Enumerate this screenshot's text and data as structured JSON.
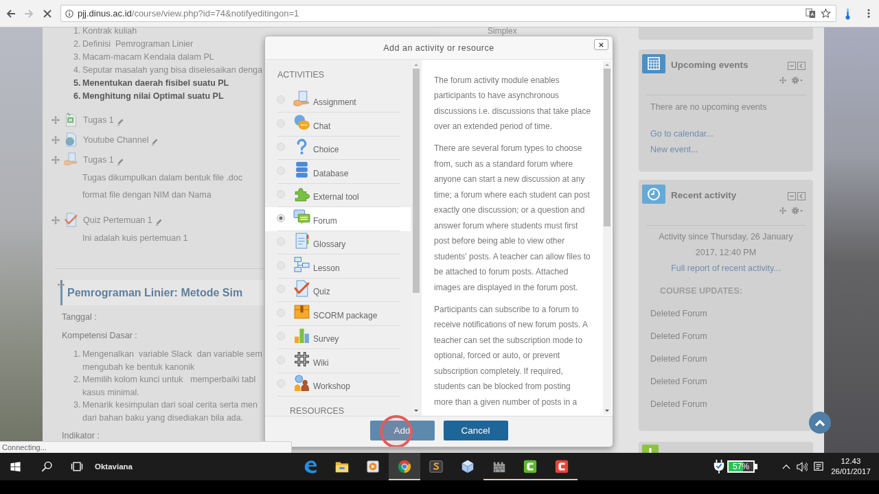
{
  "browser": {
    "url_host": "pjj.dinus.ac.id",
    "url_path": "/course/view.php?id=74&notifyeditingon=1",
    "loading": true
  },
  "page": {
    "topics": [
      {
        "number": "1.",
        "text": "Kontrak kuliah",
        "bold": false
      },
      {
        "number": "2.",
        "text": "Definisi  Pemrograman Linier",
        "bold": false
      },
      {
        "number": "3.",
        "text": "Macam-macam Kendala dalam PL",
        "bold": false
      },
      {
        "number": "4.",
        "text": "Seputar masalah yang bisa diselesaikan denga",
        "bold": false
      },
      {
        "number": "5.",
        "text": "Menentukan daerah fisibel suatu PL",
        "bold": true
      },
      {
        "number": "6.",
        "text": "Menghitung nilai Optimal suatu PL",
        "bold": true
      }
    ],
    "activities": [
      {
        "kind": "spreadsheet",
        "name": "Tugas 1"
      },
      {
        "kind": "url",
        "name": "Youtube Channel"
      },
      {
        "kind": "assignment",
        "name": "Tugas 1",
        "description": [
          "Tugas dikumpulkan dalam bentuk file .doc",
          "format file dengan NIM dan Nama"
        ]
      },
      {
        "kind": "quiz",
        "name": "Quiz Pertemuan 1",
        "description": [
          "Ini adalah kuis pertemuan 1"
        ]
      }
    ],
    "section": {
      "title": "Pemrograman Linier: Metode Sim",
      "date_label": "Tanggal :",
      "competence_label": "Kompetensi Dasar :",
      "competences": [
        {
          "number": "1.",
          "lines": [
            "Mengenalkan  variable Slack  dan variable sem",
            "mengubah ke bentuk kanonik"
          ]
        },
        {
          "number": "2.",
          "lines": [
            "Memilih kolom kunci untuk   memperbaiki tabl",
            "kasus minimal."
          ]
        },
        {
          "number": "3.",
          "lines": [
            "Menarik kesimpulan dari soal cerita serta men",
            "dari bahan baku yang disediakan bila ada."
          ]
        }
      ],
      "indicator_label": "Indikator :"
    },
    "side_text": "Simplex"
  },
  "sidebar": {
    "upcoming_events": {
      "title": "Upcoming events",
      "message": "There are no upcoming events",
      "links": [
        "Go to calendar...",
        "New event..."
      ]
    },
    "recent_activity": {
      "title": "Recent activity",
      "since": "Activity since Thursday, 26 January 2017, 12:40 PM",
      "report_link": "Full report of recent activity...",
      "updates_heading": "COURSE UPDATES:",
      "updates": [
        "Deleted Forum",
        "Deleted Forum",
        "Deleted Forum",
        "Deleted Forum",
        "Deleted Forum"
      ]
    }
  },
  "modal": {
    "title": "Add an activity or resource",
    "activities_heading": "ACTIVITIES",
    "activities": [
      {
        "kind": "assignment",
        "label": "Assignment",
        "selected": false
      },
      {
        "kind": "chat",
        "label": "Chat",
        "selected": false
      },
      {
        "kind": "choice",
        "label": "Choice",
        "selected": false
      },
      {
        "kind": "database",
        "label": "Database",
        "selected": false
      },
      {
        "kind": "lti",
        "label": "External tool",
        "selected": false
      },
      {
        "kind": "forum",
        "label": "Forum",
        "selected": true
      },
      {
        "kind": "glossary",
        "label": "Glossary",
        "selected": false
      },
      {
        "kind": "lesson",
        "label": "Lesson",
        "selected": false
      },
      {
        "kind": "quiz",
        "label": "Quiz",
        "selected": false
      },
      {
        "kind": "scorm",
        "label": "SCORM package",
        "selected": false
      },
      {
        "kind": "survey",
        "label": "Survey",
        "selected": false
      },
      {
        "kind": "wiki",
        "label": "Wiki",
        "selected": false
      },
      {
        "kind": "workshop",
        "label": "Workshop",
        "selected": false
      }
    ],
    "resources_heading": "RESOURCES",
    "description": [
      [
        "The forum activity module enables",
        "participants to have asynchronous",
        "discussions i.e. discussions that take place",
        "over an extended period of time."
      ],
      [
        "There are several forum types to choose",
        "from, such as a standard forum where",
        "anyone can start a new discussion at any",
        "time; a forum where each student can post",
        "exactly one discussion; or a question and",
        "answer forum where students must first",
        "post before being able to view other",
        "students' posts. A teacher can allow files to",
        "be attached to forum posts. Attached",
        "images are displayed in the forum post."
      ],
      [
        "Participants can subscribe to a forum to",
        "receive notifications of new forum posts. A",
        "teacher can set the subscription mode to",
        "optional, forced or auto, or prevent",
        "subscription completely. If required,",
        "students can be blocked from posting",
        "more than a given number of posts in a"
      ]
    ],
    "buttons": [
      {
        "label": "Add",
        "pressed": true
      },
      {
        "label": "Cancel",
        "pressed": false
      }
    ]
  },
  "status_bubble": "Connecting...",
  "taskbar": {
    "user": "Oktaviana",
    "apps": [
      {
        "kind": "edge",
        "running": false,
        "active": false
      },
      {
        "kind": "folder",
        "running": false,
        "active": false
      },
      {
        "kind": "media",
        "running": false,
        "active": false
      },
      {
        "kind": "chrome",
        "running": true,
        "active": true
      },
      {
        "kind": "stile",
        "running": false,
        "active": false
      },
      {
        "kind": "cube",
        "running": false,
        "active": false
      },
      {
        "kind": "wall",
        "running": true,
        "active": false
      },
      {
        "kind": "greenc",
        "running": true,
        "active": false
      },
      {
        "kind": "redc",
        "running": true,
        "active": false
      }
    ],
    "battery": "57%",
    "time": "12.43",
    "date": "26/01/2017"
  }
}
